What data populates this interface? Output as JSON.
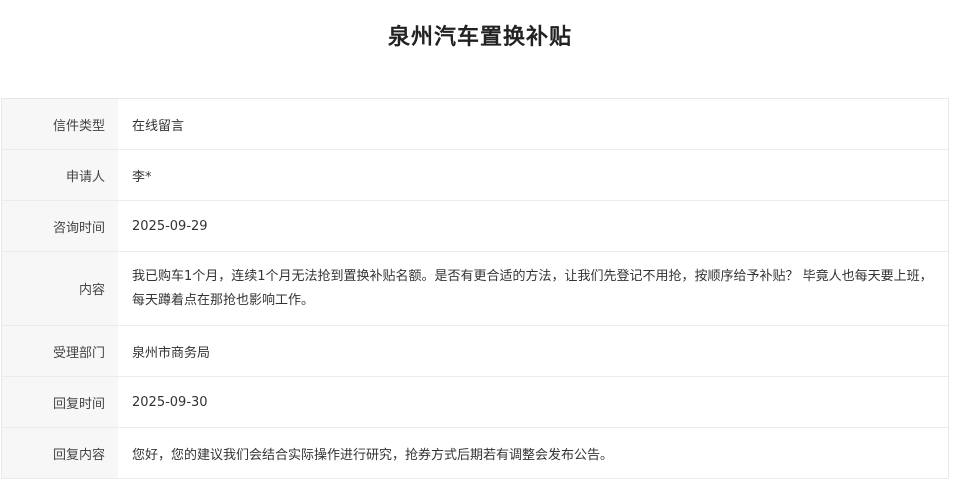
{
  "page": {
    "title": "泉州汽车置换补贴"
  },
  "letter": {
    "rows": [
      {
        "label": "信件类型",
        "value": "在线留言"
      },
      {
        "label": "申请人",
        "value": "李*"
      },
      {
        "label": "咨询时间",
        "value": "2025-09-29"
      },
      {
        "label": "内容",
        "value": "我已购车1个月，连续1个月无法抢到置换补贴名额。是否有更合适的方法，让我们先登记不用抢，按顺序给予补贴？ 毕竟人也每天要上班，每天蹲着点在那抢也影响工作。"
      },
      {
        "label": "受理部门",
        "value": "泉州市商务局"
      },
      {
        "label": "回复时间",
        "value": "2025-09-30"
      },
      {
        "label": "回复内容",
        "value": "您好，您的建议我们会结合实际操作进行研究，抢券方式后期若有调整会发布公告。"
      }
    ]
  }
}
